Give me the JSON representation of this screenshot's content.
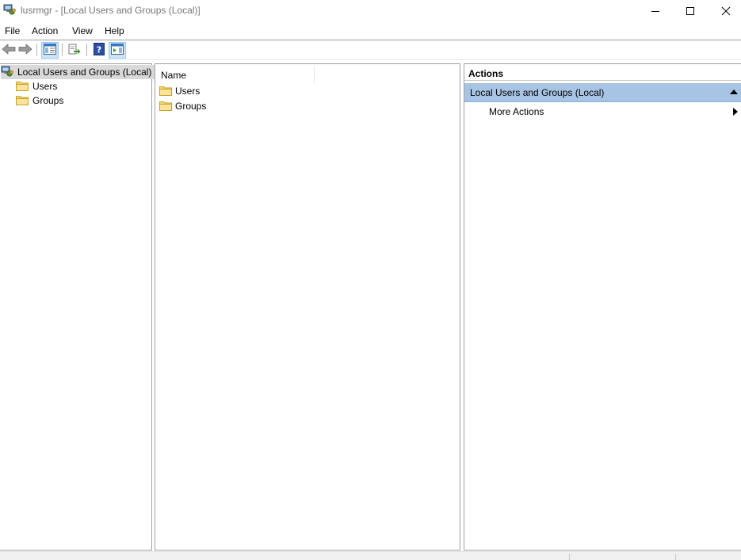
{
  "window": {
    "title": "lusrmgr - [Local Users and Groups (Local)]",
    "icon": "computer-management-icon"
  },
  "menu": {
    "file": "File",
    "action": "Action",
    "view": "View",
    "help": "Help"
  },
  "toolbar": {
    "buttons": [
      "back-arrow-icon",
      "forward-arrow-icon",
      "show-hide-console-tree-icon",
      "export-list-icon",
      "help-icon",
      "show-hide-action-pane-icon"
    ]
  },
  "tree": {
    "root": "Local Users and Groups (Local)",
    "children": [
      "Users",
      "Groups"
    ]
  },
  "list": {
    "column_name": "Name",
    "items": [
      "Users",
      "Groups"
    ]
  },
  "actions": {
    "header": "Actions",
    "group_label": "Local Users and Groups (Local)",
    "more_actions": "More Actions"
  },
  "colors": {
    "selection": "#d9d9d9",
    "actions_group_bg": "#a7c4e4",
    "toolbar_active": "#cce4f7"
  }
}
